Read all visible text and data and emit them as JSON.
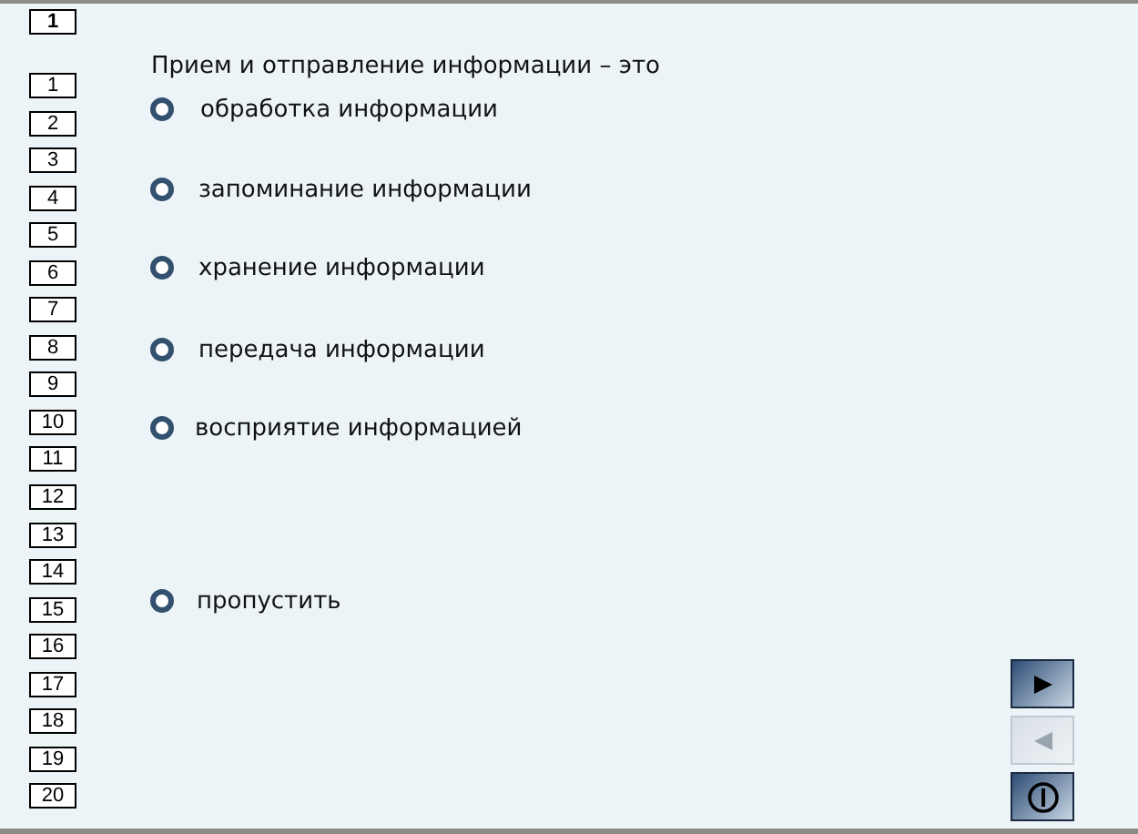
{
  "current_question": "1",
  "question_numbers": [
    {
      "label": "1",
      "selected": false
    },
    {
      "label": "2",
      "selected": false
    },
    {
      "label": "3",
      "selected": false
    },
    {
      "label": "4",
      "selected": false
    },
    {
      "label": "5",
      "selected": false
    },
    {
      "label": "6",
      "selected": false
    },
    {
      "label": "7",
      "selected": false
    },
    {
      "label": "8",
      "selected": false
    },
    {
      "label": "9",
      "selected": false
    },
    {
      "label": "10",
      "selected": false
    },
    {
      "label": "11",
      "selected": false
    },
    {
      "label": "12",
      "selected": false
    },
    {
      "label": "13",
      "selected": false
    },
    {
      "label": "14",
      "selected": false
    },
    {
      "label": "15",
      "selected": false
    },
    {
      "label": "16",
      "selected": false
    },
    {
      "label": "17",
      "selected": false
    },
    {
      "label": "18",
      "selected": false
    },
    {
      "label": "19",
      "selected": false
    },
    {
      "label": "20",
      "selected": false
    }
  ],
  "question": "Прием и отправление информации – это",
  "options": [
    {
      "label": "обработка информации",
      "selected": false
    },
    {
      "label": "запоминание информации",
      "selected": false
    },
    {
      "label": "хранение информации",
      "selected": false
    },
    {
      "label": "передача информации",
      "selected": false
    },
    {
      "label": "восприятие информацией",
      "selected": false
    }
  ],
  "skip_option": {
    "label": "пропустить",
    "selected": false
  },
  "nav_buttons": [
    {
      "kind": "next",
      "disabled": false
    },
    {
      "kind": "previous",
      "disabled": true
    },
    {
      "kind": "finish",
      "disabled": false
    }
  ]
}
